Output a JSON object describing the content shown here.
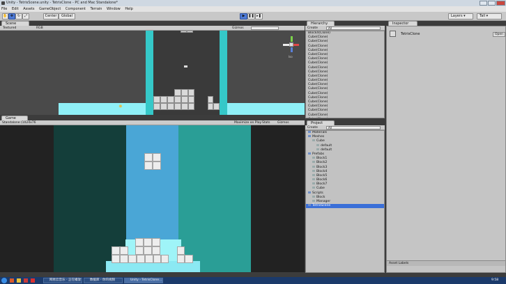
{
  "window": {
    "title": "Unity - TetrisScene.unity - TetrisClone - PC and Mac Standalone*"
  },
  "menu": [
    "File",
    "Edit",
    "Assets",
    "GameObject",
    "Component",
    "Terrain",
    "Window",
    "Help"
  ],
  "toolbar": {
    "pivot": "Center",
    "space": "Global",
    "layers": "Layers",
    "layout": "Tall"
  },
  "scene": {
    "tab": "Scene",
    "render_mode": "Textured",
    "color_mode": "RGB",
    "gizmos": "Gizmos",
    "persp": "Iso"
  },
  "game": {
    "tab": "Game",
    "aspect": "Standalone (1024x76",
    "maximize": "Maximize on Play",
    "stats": "Stats",
    "gizmos": "Gizmos"
  },
  "hierarchy": {
    "tab": "Hierarchy",
    "create": "Create",
    "search": "All",
    "items": [
      "Block4(Clone)",
      "Cube(Clone)",
      "Cube(Clone)",
      "Cube(Clone)",
      "Cube(Clone)",
      "Cube(Clone)",
      "Cube(Clone)",
      "Cube(Clone)",
      "Cube(Clone)",
      "Cube(Clone)",
      "Cube(Clone)",
      "Cube(Clone)",
      "Cube(Clone)",
      "Cube(Clone)",
      "Cube(Clone)",
      "Cube(Clone)",
      "Cube(Clone)",
      "Cube(Clone)",
      "Cube(Clone)",
      "Cube(Clone)",
      "Cube(Clone)",
      "Cube(Clone)",
      "Cube(Clone)",
      "Cube(Clone)",
      "Directional light",
      "Floor",
      "Main Camera"
    ]
  },
  "project": {
    "tab": "Project",
    "create": "Create",
    "search": "All",
    "items": [
      {
        "label": "Materials",
        "depth": 0
      },
      {
        "label": "Meshes",
        "depth": 0
      },
      {
        "label": "Cube",
        "depth": 1
      },
      {
        "label": "default",
        "depth": 2
      },
      {
        "label": "default",
        "depth": 2
      },
      {
        "label": "Prefabs",
        "depth": 0
      },
      {
        "label": "Block1",
        "depth": 1
      },
      {
        "label": "Block2",
        "depth": 1
      },
      {
        "label": "Block3",
        "depth": 1
      },
      {
        "label": "Block4",
        "depth": 1
      },
      {
        "label": "Block5",
        "depth": 1
      },
      {
        "label": "Block6",
        "depth": 1
      },
      {
        "label": "Block7",
        "depth": 1
      },
      {
        "label": "Cube",
        "depth": 1
      },
      {
        "label": "Scripts",
        "depth": 0
      },
      {
        "label": "Block",
        "depth": 1
      },
      {
        "label": "Manager",
        "depth": 1
      },
      {
        "label": "TetrisScene",
        "depth": 0
      }
    ]
  },
  "inspector": {
    "tab": "Inspector",
    "object": "TetrisClone",
    "open_label": "Open",
    "asset_labels": "Asset Labels"
  },
  "taskbar": {
    "items": [
      "网易云音乐 - 正在播放",
      "数据库 - 你的视频",
      "Unity - TetrisClone..."
    ],
    "time": "9:58"
  },
  "colors": {
    "cyan": "#4fe0e5",
    "sky": "#4aa6d6",
    "teal": "#2a9e96",
    "dark_teal": "#143e3a",
    "floor": "#8ff0f7"
  }
}
